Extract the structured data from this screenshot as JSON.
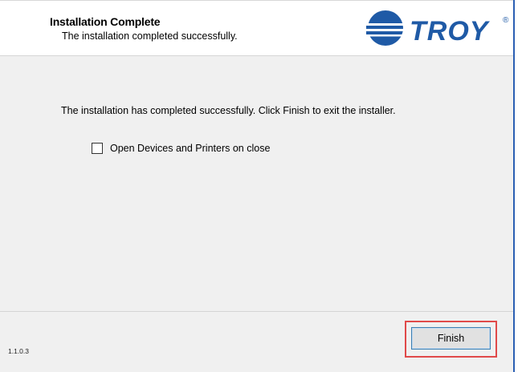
{
  "header": {
    "title": "Installation Complete",
    "subtitle": "The installation completed successfully.",
    "logo_text": "TROY",
    "logo_mark": "®"
  },
  "body": {
    "message": "The installation has completed successfully. Click Finish to exit the installer.",
    "checkbox": {
      "label": "Open Devices and Printers on close",
      "checked": false
    }
  },
  "footer": {
    "version": "1.1.0.3",
    "finish_label": "Finish"
  },
  "colors": {
    "brand": "#1f5aa6",
    "highlight": "#e04a4a",
    "button_border": "#3c7fb1",
    "panel_background": "#f0f0f0"
  }
}
